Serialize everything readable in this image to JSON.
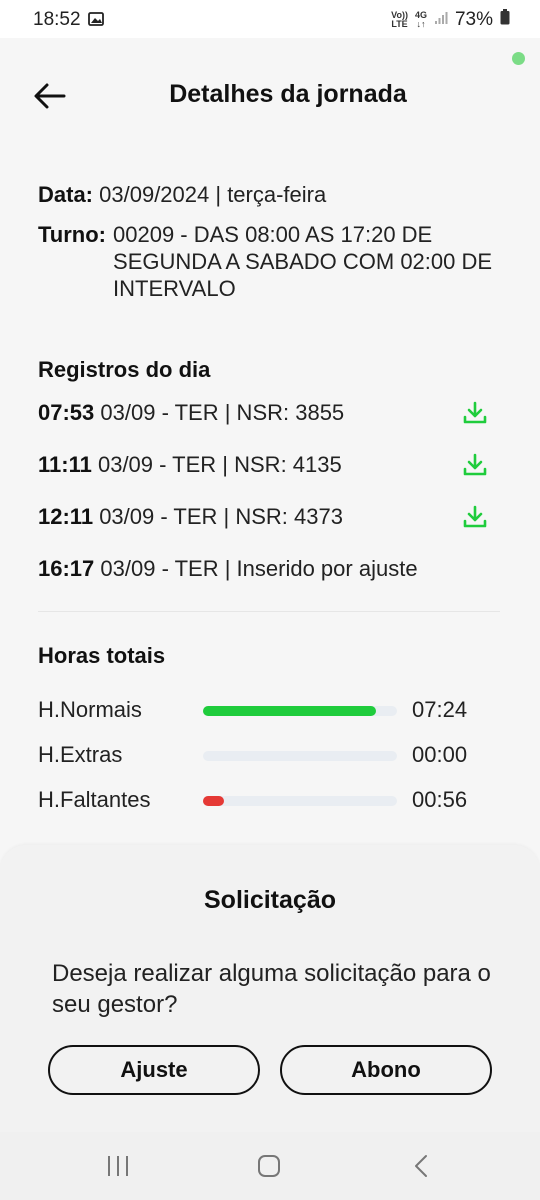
{
  "status_bar": {
    "time": "18:52",
    "volte_top": "Vo))",
    "volte_bottom": "LTE",
    "network_top": "4G",
    "network_bottom": "↓↑",
    "battery": "73%"
  },
  "header": {
    "title": "Detalhes da jornada"
  },
  "info": {
    "data_label": "Data:",
    "data_value": "03/09/2024 | terça-feira",
    "turno_label": "Turno:",
    "turno_value": "00209 - DAS 08:00 AS 17:20 DE SEGUNDA A SABADO COM 02:00 DE INTERVALO"
  },
  "registros": {
    "title": "Registros do dia",
    "items": [
      {
        "time": "07:53",
        "detail": "03/09 - TER | NSR: 3855",
        "download": true
      },
      {
        "time": "11:11",
        "detail": "03/09 - TER | NSR: 4135",
        "download": true
      },
      {
        "time": "12:11",
        "detail": "03/09 - TER | NSR: 4373",
        "download": true
      },
      {
        "time": "16:17",
        "detail": "03/09 - TER | Inserido por ajuste",
        "download": false
      }
    ]
  },
  "horas": {
    "title": "Horas totais",
    "rows": [
      {
        "label": "H.Normais",
        "value": "07:24",
        "fill_fraction": 0.89,
        "color": "#1fcc3c"
      },
      {
        "label": "H.Extras",
        "value": "00:00",
        "fill_fraction": 0.0,
        "color": "#1fcc3c"
      },
      {
        "label": "H.Faltantes",
        "value": "00:56",
        "fill_fraction": 0.11,
        "color": "#e53935"
      }
    ]
  },
  "sheet": {
    "title": "Solicitação",
    "message": "Deseja realizar alguma solicitação para o seu gestor?",
    "btn_ajuste": "Ajuste",
    "btn_abono": "Abono"
  },
  "colors": {
    "accent_green": "#1fcc3c",
    "alert_red": "#e53935",
    "dot_green": "#7bdc86"
  },
  "icons": [
    "image-icon",
    "signal-icon",
    "battery-icon",
    "arrow-left-icon",
    "download-icon",
    "recent-apps-icon",
    "home-icon",
    "back-icon"
  ]
}
